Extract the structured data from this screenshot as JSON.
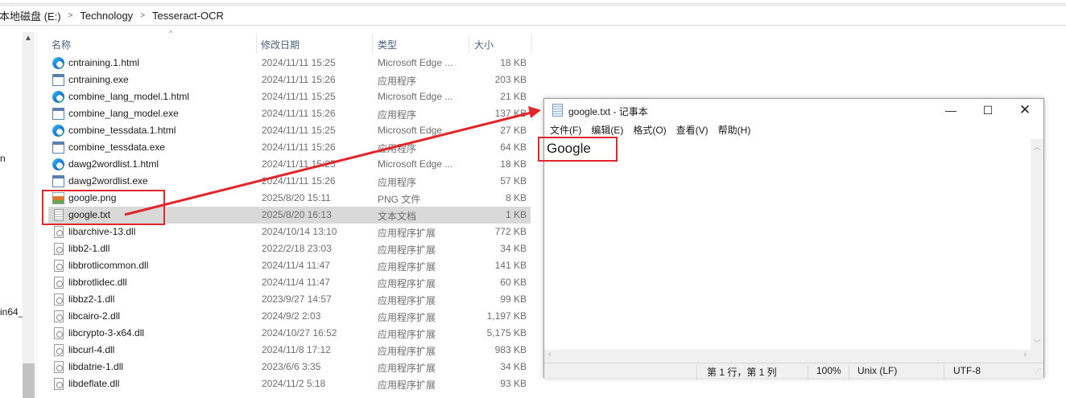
{
  "breadcrumb": [
    "本地磁盘 (E:)",
    "Technology",
    "Tesseract-OCR"
  ],
  "nav_fragments": [
    "n",
    "in64_"
  ],
  "columns": {
    "name": "名称",
    "date": "修改日期",
    "type": "类型",
    "size": "大小"
  },
  "files": [
    {
      "name": "cntraining.1.html",
      "date": "2024/11/11 15:25",
      "type": "Microsoft Edge ...",
      "size": "18 KB",
      "icon": "edge"
    },
    {
      "name": "cntraining.exe",
      "date": "2024/11/11 15:26",
      "type": "应用程序",
      "size": "203 KB",
      "icon": "exe"
    },
    {
      "name": "combine_lang_model.1.html",
      "date": "2024/11/11 15:25",
      "type": "Microsoft Edge ...",
      "size": "21 KB",
      "icon": "edge"
    },
    {
      "name": "combine_lang_model.exe",
      "date": "2024/11/11 15:26",
      "type": "应用程序",
      "size": "137 KB",
      "icon": "exe"
    },
    {
      "name": "combine_tessdata.1.html",
      "date": "2024/11/11 15:25",
      "type": "Microsoft Edge ...",
      "size": "27 KB",
      "icon": "edge"
    },
    {
      "name": "combine_tessdata.exe",
      "date": "2024/11/11 15:26",
      "type": "应用程序",
      "size": "64 KB",
      "icon": "exe"
    },
    {
      "name": "dawg2wordlist.1.html",
      "date": "2024/11/11 15:25",
      "type": "Microsoft Edge ...",
      "size": "18 KB",
      "icon": "edge"
    },
    {
      "name": "dawg2wordlist.exe",
      "date": "2024/11/11 15:26",
      "type": "应用程序",
      "size": "57 KB",
      "icon": "exe"
    },
    {
      "name": "google.png",
      "date": "2025/8/20 15:11",
      "type": "PNG 文件",
      "size": "8 KB",
      "icon": "png"
    },
    {
      "name": "google.txt",
      "date": "2025/8/20 16:13",
      "type": "文本文档",
      "size": "1 KB",
      "icon": "txt",
      "selected": true
    },
    {
      "name": "libarchive-13.dll",
      "date": "2024/10/14 13:10",
      "type": "应用程序扩展",
      "size": "772 KB",
      "icon": "dll"
    },
    {
      "name": "libb2-1.dll",
      "date": "2022/2/18 23:03",
      "type": "应用程序扩展",
      "size": "34 KB",
      "icon": "dll"
    },
    {
      "name": "libbrotlicommon.dll",
      "date": "2024/11/4 11:47",
      "type": "应用程序扩展",
      "size": "141 KB",
      "icon": "dll"
    },
    {
      "name": "libbrotlidec.dll",
      "date": "2024/11/4 11:47",
      "type": "应用程序扩展",
      "size": "60 KB",
      "icon": "dll"
    },
    {
      "name": "libbz2-1.dll",
      "date": "2023/9/27 14:57",
      "type": "应用程序扩展",
      "size": "99 KB",
      "icon": "dll"
    },
    {
      "name": "libcairo-2.dll",
      "date": "2024/9/2 2:03",
      "type": "应用程序扩展",
      "size": "1,197 KB",
      "icon": "dll"
    },
    {
      "name": "libcrypto-3-x64.dll",
      "date": "2024/10/27 16:52",
      "type": "应用程序扩展",
      "size": "5,175 KB",
      "icon": "dll"
    },
    {
      "name": "libcurl-4.dll",
      "date": "2024/11/8 17:12",
      "type": "应用程序扩展",
      "size": "983 KB",
      "icon": "dll"
    },
    {
      "name": "libdatrie-1.dll",
      "date": "2023/6/6 3:35",
      "type": "应用程序扩展",
      "size": "34 KB",
      "icon": "dll"
    },
    {
      "name": "libdeflate.dll",
      "date": "2024/11/2 5:18",
      "type": "应用程序扩展",
      "size": "93 KB",
      "icon": "dll"
    }
  ],
  "notepad": {
    "title": "google.txt - 记事本",
    "menu": [
      "文件(F)",
      "编辑(E)",
      "格式(O)",
      "查看(V)",
      "帮助(H)"
    ],
    "content": "Google",
    "status": {
      "position": "第 1 行，第 1 列",
      "zoom": "100%",
      "line_ending": "Unix (LF)",
      "encoding": "UTF-8"
    }
  },
  "annotation_color": "#e0262a"
}
